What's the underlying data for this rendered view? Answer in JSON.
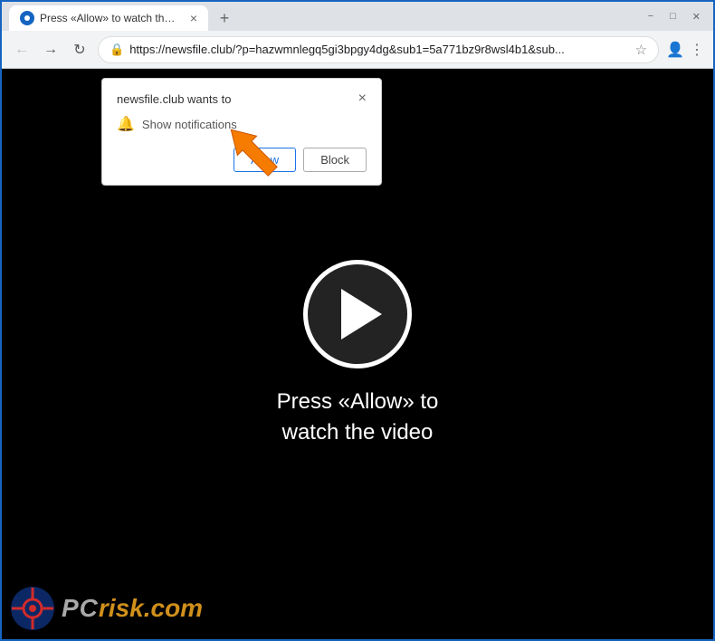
{
  "browser": {
    "tab": {
      "title": "Press «Allow» to watch the video",
      "favicon": "●"
    },
    "new_tab_icon": "+",
    "window_controls": {
      "minimize": "−",
      "maximize": "□",
      "close": "✕"
    },
    "address_bar": {
      "url": "https://newsfile.club/?p=hazwmnlegq5gi3bpgy4dg&sub1=5a771bz9r8wsl4b1&sub...",
      "lock_icon": "🔒"
    },
    "nav": {
      "back": "←",
      "forward": "→",
      "refresh": "↻"
    }
  },
  "notification_popup": {
    "title": "newsfile.club wants to",
    "close_icon": "×",
    "notification_row": {
      "icon": "🔔",
      "label": "Show notifications"
    },
    "buttons": {
      "allow": "Allow",
      "block": "Block"
    }
  },
  "video": {
    "prompt_text": "Press «Allow» to\nwatch the video"
  },
  "watermark": {
    "text_pc": "PC",
    "text_risk": "risk",
    "text_dot": ".",
    "text_com": "com"
  }
}
